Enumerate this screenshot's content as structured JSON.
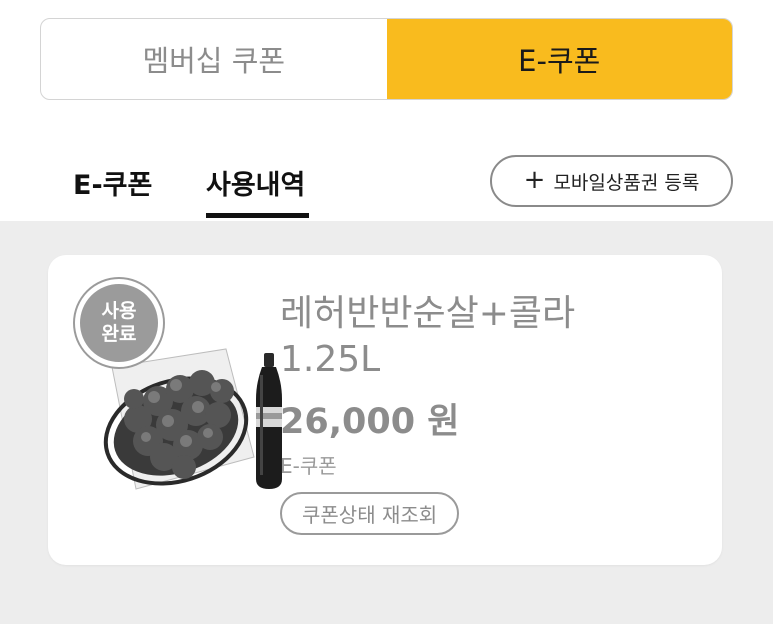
{
  "segment": {
    "membership_label": "멤버십 쿠폰",
    "ecoupon_label": "E-쿠폰",
    "accent_color": "#f9bb1e"
  },
  "subtabs": {
    "ecoupon_label": "E-쿠폰",
    "history_label": "사용내역",
    "active": "사용내역"
  },
  "register_button": {
    "icon": "plus-icon",
    "label": "모바일상품권 등록"
  },
  "coupon": {
    "badge_line1": "사용",
    "badge_line2": "완료",
    "title_line1": "레허반반순살+콜라",
    "title_line2": "1.25L",
    "price": "26,000 원",
    "type": "E-쿠폰",
    "recheck_label": "쿠폰상태 재조회"
  }
}
